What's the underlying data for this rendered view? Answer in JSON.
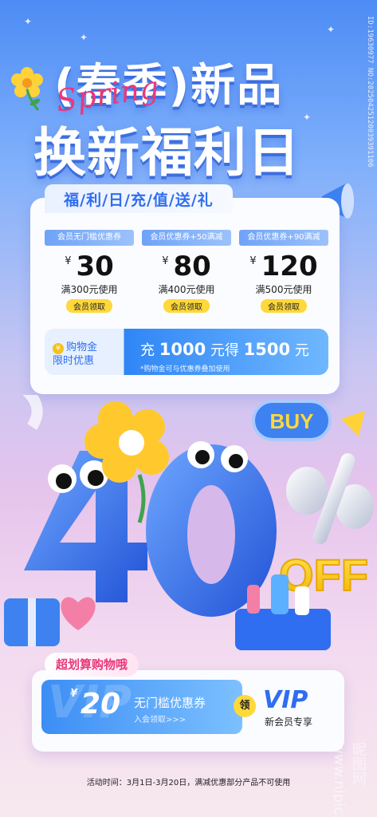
{
  "title": {
    "line1": "(春季)新品",
    "line2": "换新福利日",
    "script_word": "Spring"
  },
  "side_watermark": "ID:19630977 NO:20250425120039391106",
  "card": {
    "tab_label": "福/利/日/充/值/送/礼",
    "coupons": [
      {
        "head": "会员无门槛优惠券",
        "currency": "¥",
        "amount": "30",
        "condition": "满300元使用",
        "button": "会员领取"
      },
      {
        "head": "会员优惠券+50满减",
        "currency": "¥",
        "amount": "80",
        "condition": "满400元使用",
        "button": "会员领取"
      },
      {
        "head": "会员优惠券+90满减",
        "currency": "¥",
        "amount": "120",
        "condition": "满500元使用",
        "button": "会员领取"
      }
    ],
    "recharge": {
      "coin_glyph": "¥",
      "label_line1": "购物金",
      "label_line2": "限时优惠",
      "pre": "充",
      "amount_in": "1000",
      "mid": "元得",
      "amount_out": "1500",
      "post": "元",
      "note": "*购物金可与优惠券叠加使用"
    }
  },
  "graphic": {
    "big_number": "40",
    "buy_badge": "BUY",
    "off_text": "OFF",
    "percent": "%"
  },
  "bottom": {
    "tag": "超划算购物哦",
    "vip_bg": "VIP",
    "currency": "¥",
    "amount": "20",
    "coupon_name": "无门槛优惠券",
    "coupon_link": "入会领取>>>",
    "claim": "领",
    "vip_title": "VIP",
    "vip_subtitle": "新会员专享"
  },
  "footer": "活动时间：3月1日-3月20日，满减优惠部分产品不可使用",
  "bottom_watermark": "昵图网 www.nipic.com",
  "colors": {
    "brand_blue": "#2f6ef0",
    "accent_pink": "#e8397a",
    "accent_yellow": "#ffd83a"
  }
}
